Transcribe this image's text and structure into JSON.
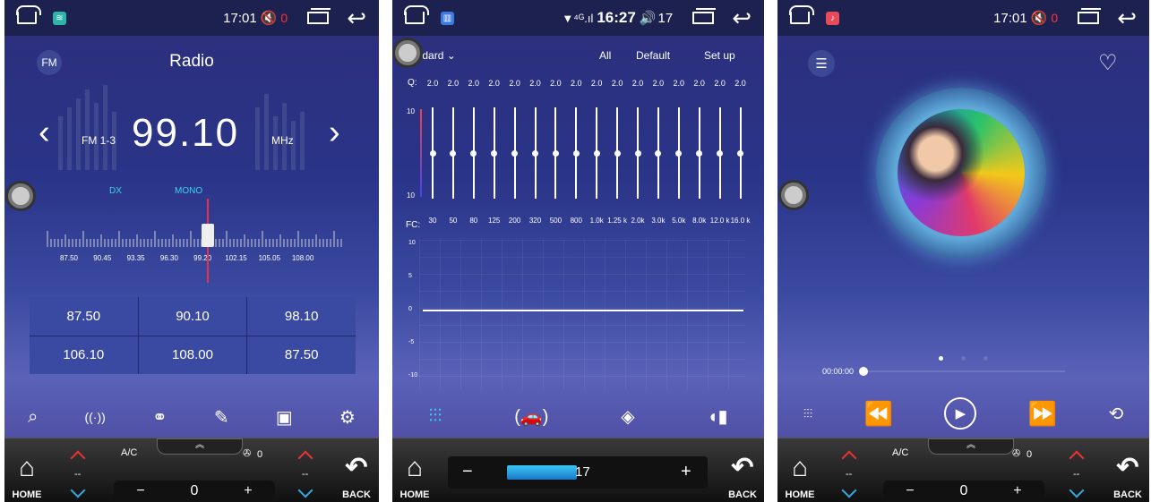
{
  "screens": [
    {
      "status": {
        "time": "17:01",
        "mute_count": "0"
      },
      "radio": {
        "band_button": "FM",
        "title": "Radio",
        "prev": "‹",
        "next": "›",
        "preset_group": "FM 1-3",
        "frequency": "99.10",
        "unit": "MHz",
        "dx": "DX",
        "mono": "MONO",
        "scale_labels": [
          "87.50",
          "90.45",
          "93.35",
          "96.30",
          "99.20",
          "102.15",
          "105.05",
          "108.00"
        ],
        "presets": [
          "87.50",
          "90.10",
          "98.10",
          "106.10",
          "108.00",
          "87.50"
        ],
        "toolbar": [
          "search-icon",
          "signal-icon",
          "stereo-icon",
          "edit-icon",
          "save-icon",
          "settings-icon"
        ]
      },
      "bottom": {
        "home": "HOME",
        "back": "BACK",
        "ac": "A/C",
        "fan": "0",
        "temp_left": "--",
        "temp_right": "--",
        "stepper_minus": "−",
        "stepper_value": "0",
        "stepper_plus": "+"
      }
    },
    {
      "status": {
        "time": "16:27",
        "volume": "17"
      },
      "eq": {
        "preset": "andard",
        "tabs": [
          "All",
          "Default",
          "Set up"
        ],
        "q_label": "Q:",
        "q_values": [
          "2.0",
          "2.0",
          "2.0",
          "2.0",
          "2.0",
          "2.0",
          "2.0",
          "2.0",
          "2.0",
          "2.0",
          "2.0",
          "2.0",
          "2.0",
          "2.0",
          "2.0",
          "2.0"
        ],
        "fc_label": "FC:",
        "fc_values": [
          "30",
          "50",
          "80",
          "125",
          "200",
          "320",
          "500",
          "800",
          "1.0k",
          "1.25 k",
          "2.0k",
          "3.0k",
          "5.0k",
          "8.0k",
          "12.0 k",
          "16.0 k"
        ],
        "slider_top": "10",
        "slider_bottom": "10",
        "graph_ticks": [
          "10",
          "5",
          "0",
          "-5",
          "-10"
        ],
        "toolbar": [
          "equalizer-icon",
          "car-sound-icon",
          "balance-icon",
          "sound-effect-icon"
        ]
      },
      "bottom": {
        "home": "HOME",
        "back": "BACK",
        "minus": "−",
        "volume": "17",
        "plus": "+"
      }
    },
    {
      "status": {
        "time": "17:01",
        "mute_count": "0"
      },
      "music": {
        "elapsed": "00:00:00",
        "toolbar": [
          "equalizer-icon",
          "rewind-icon",
          "play-icon",
          "fast-forward-icon",
          "repeat-icon"
        ]
      },
      "bottom": {
        "home": "HOME",
        "back": "BACK",
        "ac": "A/C",
        "fan": "0",
        "temp_left": "--",
        "temp_right": "--",
        "stepper_minus": "−",
        "stepper_value": "0",
        "stepper_plus": "+"
      }
    }
  ]
}
